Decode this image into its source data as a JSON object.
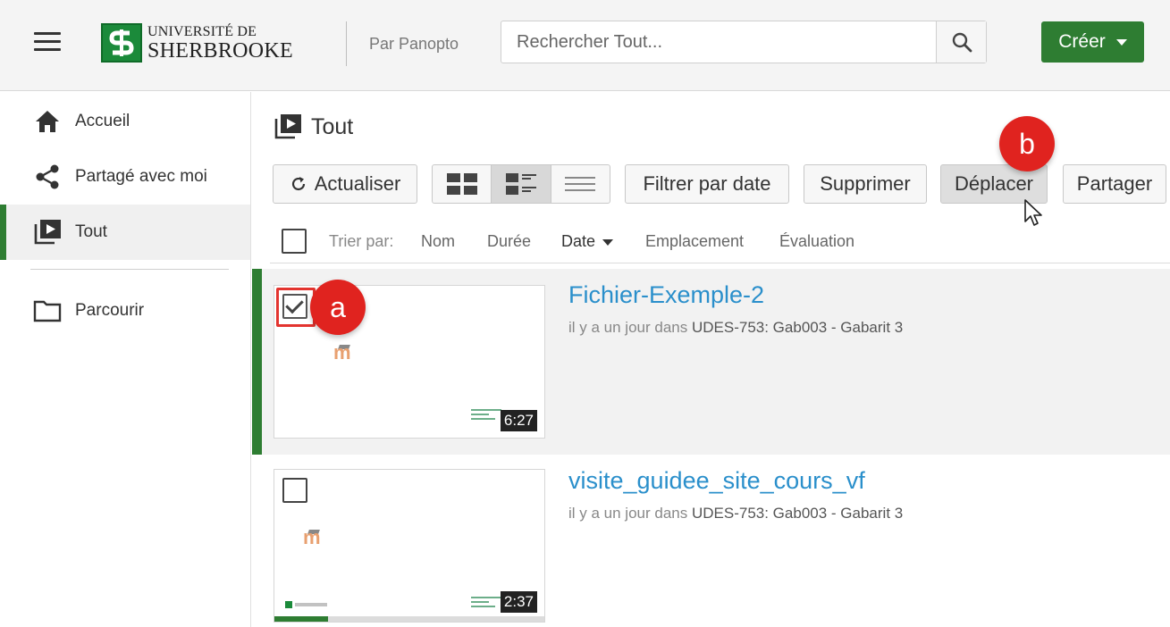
{
  "header": {
    "logo_line1": "UNIVERSITÉ DE",
    "logo_line2": "SHERBROOKE",
    "by_label": "Par Panopto",
    "search_placeholder": "Rechercher Tout...",
    "create_label": "Créer",
    "brand_color": "#2e7d32"
  },
  "sidebar": {
    "items": [
      {
        "label": "Accueil",
        "icon": "home-icon"
      },
      {
        "label": "Partagé avec moi",
        "icon": "share-icon"
      },
      {
        "label": "Tout",
        "icon": "video-library-icon",
        "active": true
      },
      {
        "label": "Parcourir",
        "icon": "folder-icon"
      }
    ]
  },
  "main": {
    "title": "Tout",
    "toolbar": {
      "refresh": "Actualiser",
      "filter_date": "Filtrer par date",
      "delete": "Supprimer",
      "move": "Déplacer",
      "share": "Partager"
    },
    "sort": {
      "label": "Trier par:",
      "options": [
        "Nom",
        "Durée",
        "Date",
        "Emplacement",
        "Évaluation"
      ],
      "active": "Date"
    },
    "sessions": [
      {
        "title": "Fichier-Exemple-2",
        "meta_prefix": "il y a un jour dans",
        "location": "UDES-753: Gab003 - Gabarit 3",
        "duration": "6:27",
        "checked": true
      },
      {
        "title": "visite_guidee_site_cours_vf",
        "meta_prefix": "il y a un jour dans",
        "location": "UDES-753: Gab003 - Gabarit 3",
        "duration": "2:37",
        "checked": false,
        "progress": 0.2
      }
    ]
  },
  "annotations": {
    "a": "a",
    "b": "b"
  }
}
